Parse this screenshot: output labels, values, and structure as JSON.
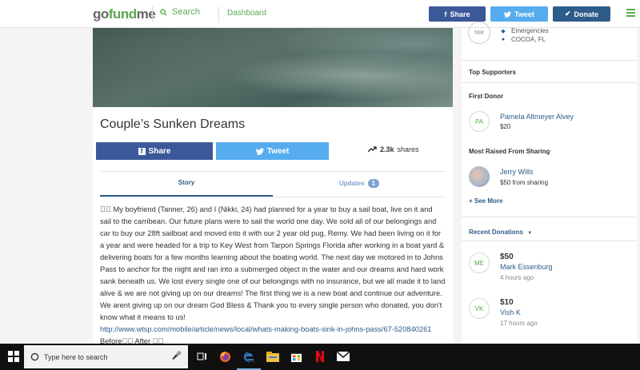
{
  "topbar": {
    "logo": {
      "go": "go",
      "fund": "fund",
      "me": "me"
    },
    "search_label": "Search",
    "dashboard_label": "Dashboard",
    "share_label": "Share",
    "tweet_label": "Tweet",
    "donate_label": "Donate"
  },
  "campaign": {
    "title": "Couple’s Sunken Dreams",
    "share_label": "Share",
    "tweet_label": "Tweet",
    "shares_count": "2.3k",
    "shares_word": "shares",
    "tab_story": "Story",
    "tab_updates": "Updates",
    "updates_badge": "1",
    "story_text": "\u0000\u0000 My boyfriend (Tanner, 26) and I (Nikki, 24) had planned for a year to buy a sail boat, live on it and sail to the carribean. Our future plans were to sail the world one day. We sold all of our belongings and car to buy our 28ft sailboat and moved into it with our 2 year old pug, Remy. We had been living on it for a year and were headed for a trip to Key West from Tarpon Springs Florida after working in a boat yard & delivering boats for a few months learning about the boating world. The next day we motored in to Johns Pass to anchor for the night and ran into a submerged object in the water and our dreams and hard work sank beneath us. We lost every single one of our belongings with no insurance, but we all made it to land alive & we are not giving up on our dreams!   The first thing we is a new boat and continue our adventure. We arent giving up on our dream God Bless & Thank you to every single person who donated, you don't know what it means to us!",
    "story_link": "http://www.wtsp.com/mobile/article/news/local/whats-making-boats-sink-in-johns-pass/67-520840261",
    "story_tail": "  Before\u0000\u0000 After \u0000\u0000"
  },
  "sidebar": {
    "organizer_initials": "NW",
    "category": "Emergencies",
    "location": "COCOA, FL",
    "top_supporters": "Top Supporters",
    "first_donor_heading": "First Donor",
    "first_donor": {
      "initials": "PA",
      "name": "Pamela Altmeyer Alvey",
      "amount": "$20"
    },
    "most_raised_heading": "Most Raised From Sharing",
    "sharer": {
      "name": "Jerry Wills",
      "detail": "$50 from sharing"
    },
    "see_more": "+ See More",
    "recent_donations": "Recent Donations",
    "donations": [
      {
        "initials": "ME",
        "amount": "$50",
        "name": "Mark Essenburg",
        "ago": "4 hours ago"
      },
      {
        "initials": "VK",
        "amount": "$10",
        "name": "Vish K",
        "ago": "17 hours ago"
      }
    ]
  },
  "taskbar": {
    "search_placeholder": "Type here to search"
  },
  "colors": {
    "brand_green": "#59a94e",
    "facebook": "#3b5998",
    "twitter": "#55acee",
    "donate": "#2e5c8a"
  }
}
